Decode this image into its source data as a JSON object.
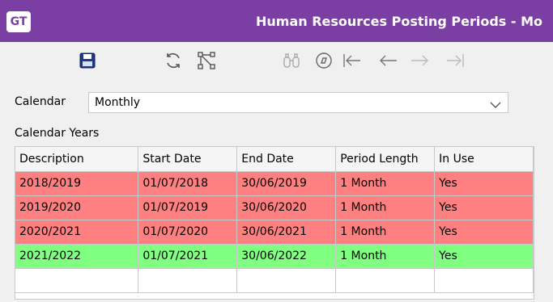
{
  "app": {
    "logo": "GT",
    "title": "Human Resources Posting Periods - Mo"
  },
  "toolbar": {
    "icons": [
      "save-icon",
      "refresh-icon",
      "hierarchy-icon",
      "binoculars-icon",
      "compass-icon",
      "first-record-icon",
      "previous-record-icon",
      "next-record-icon",
      "last-record-icon"
    ]
  },
  "calendar": {
    "label": "Calendar",
    "value": "Monthly"
  },
  "years": {
    "label": "Calendar Years",
    "columns": [
      "Description",
      "Start Date",
      "End Date",
      "Period Length",
      "In Use"
    ],
    "rows": [
      {
        "description": "2018/2019",
        "start": "01/07/2018",
        "end": "30/06/2019",
        "length": "1 Month",
        "in_use": "Yes",
        "status": "red"
      },
      {
        "description": "2019/2020",
        "start": "01/07/2019",
        "end": "30/06/2020",
        "length": "1 Month",
        "in_use": "Yes",
        "status": "red"
      },
      {
        "description": "2020/2021",
        "start": "01/07/2020",
        "end": "30/06/2021",
        "length": "1 Month",
        "in_use": "Yes",
        "status": "red"
      },
      {
        "description": "2021/2022",
        "start": "01/07/2021",
        "end": "30/06/2022",
        "length": "1 Month",
        "in_use": "Yes",
        "status": "green"
      }
    ]
  },
  "colors": {
    "titlebar": "#7b3fa3",
    "row_red": "#ff8080",
    "row_green": "#80ff80"
  }
}
